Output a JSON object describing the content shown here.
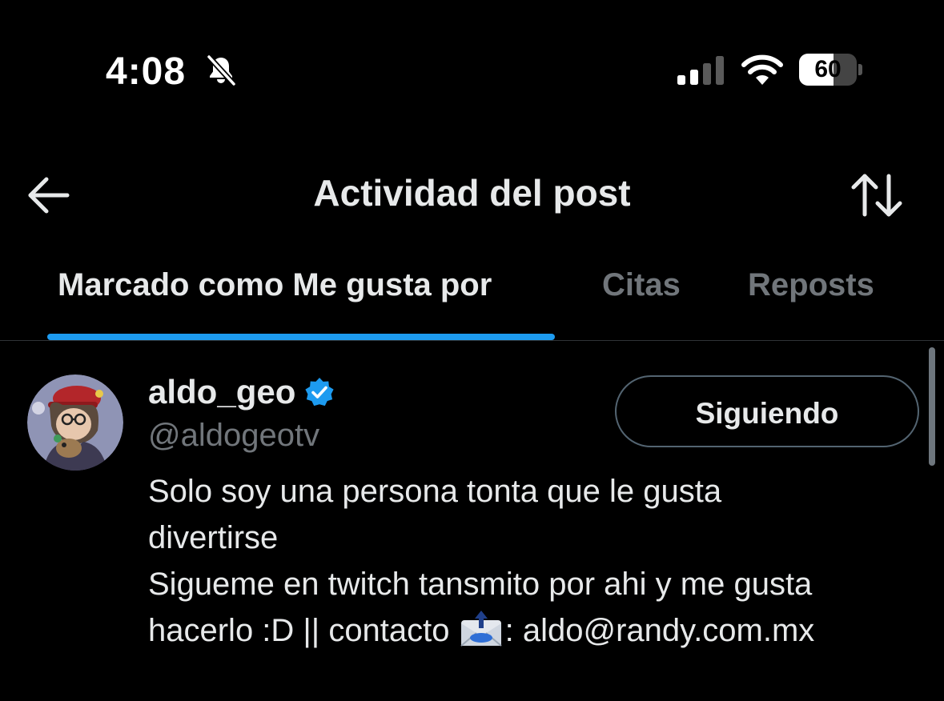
{
  "status_bar": {
    "time": "4:08",
    "battery": "60",
    "battery_fraction": 0.6,
    "icons": [
      "bell-slash-icon",
      "cellular-signal-icon",
      "wifi-icon",
      "battery-icon"
    ]
  },
  "header": {
    "title": "Actividad del post",
    "back_icon": "arrow-left-icon",
    "sort_icon": "sort-arrows-icon"
  },
  "tabs": [
    {
      "label": "Marcado como Me gusta por",
      "active": true
    },
    {
      "label": "Citas",
      "active": false
    },
    {
      "label": "Reposts",
      "active": false
    }
  ],
  "user": {
    "name": "aldo_geo",
    "handle": "@aldogeotv",
    "verified": true,
    "follow_button": "Siguiendo",
    "bio_lines": [
      "Solo soy una persona tonta que le gusta",
      "divertirse",
      "Sigueme en twitch tansmito por ahi y me gusta"
    ],
    "bio_line4_prefix": "hacerlo :D || contacto ",
    "bio_line4_suffix": ": aldo@randy.com.mx",
    "bio_emoji_icon": "envelope-arrow-icon"
  },
  "colors": {
    "background": "#000000",
    "accent": "#1d9bf0",
    "text_primary": "#e7e9ea",
    "text_secondary": "#71767b"
  }
}
